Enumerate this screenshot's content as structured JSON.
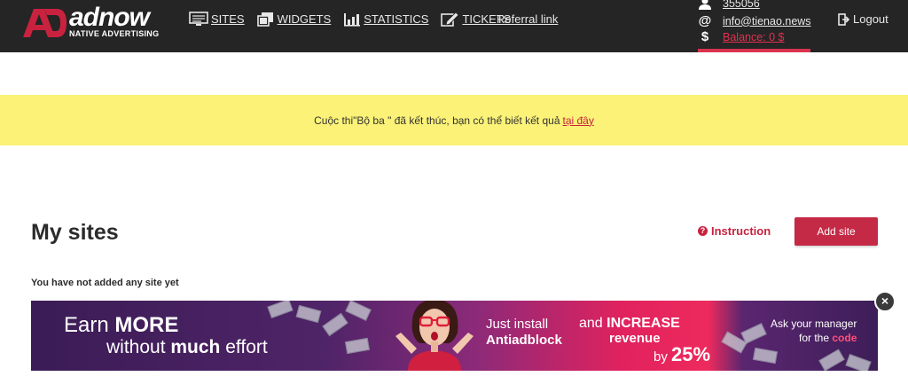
{
  "brand": {
    "name": "adnow",
    "tagline": "NATIVE ADVERTISING",
    "accent": "#c8223f"
  },
  "nav": {
    "items": [
      {
        "label": "SITES",
        "icon": "monitor-icon"
      },
      {
        "label": "WIDGETS",
        "icon": "widgets-icon"
      },
      {
        "label": "STATISTICS",
        "icon": "bar-chart-icon"
      },
      {
        "label": "TICKETS",
        "icon": "edit-icon"
      }
    ],
    "referral": "Referral link"
  },
  "account": {
    "id_icon": "user-icon",
    "id": "355056",
    "email_icon": "@",
    "email": "info@tienao.news",
    "balance_icon": "$",
    "balance": "Balance: 0 $",
    "logout": "Logout"
  },
  "notice": {
    "text": "Cuộc thi\"Bộ ba \" đã kết thúc, bạn có thể biết kết quả",
    "link": "tại đây"
  },
  "main": {
    "title": "My sites",
    "instruction": "Instruction",
    "instruction_icon": "?",
    "add_button": "Add site",
    "empty_message": "You have not added any site yet"
  },
  "banner": {
    "earn_prefix": "Earn ",
    "earn_bold": "MORE",
    "without_prefix": "without ",
    "without_bold": "much",
    "without_suffix": " effort",
    "just_install": "Just install",
    "antiadblock": "Antiadblock",
    "and_prefix": "and ",
    "and_bold": "INCREASE",
    "revenue": "revenue",
    "by_prefix": "by ",
    "by_value": "25%",
    "ask": "Ask your manager",
    "for_prefix": "for the ",
    "for_code": "code",
    "close": "×"
  }
}
